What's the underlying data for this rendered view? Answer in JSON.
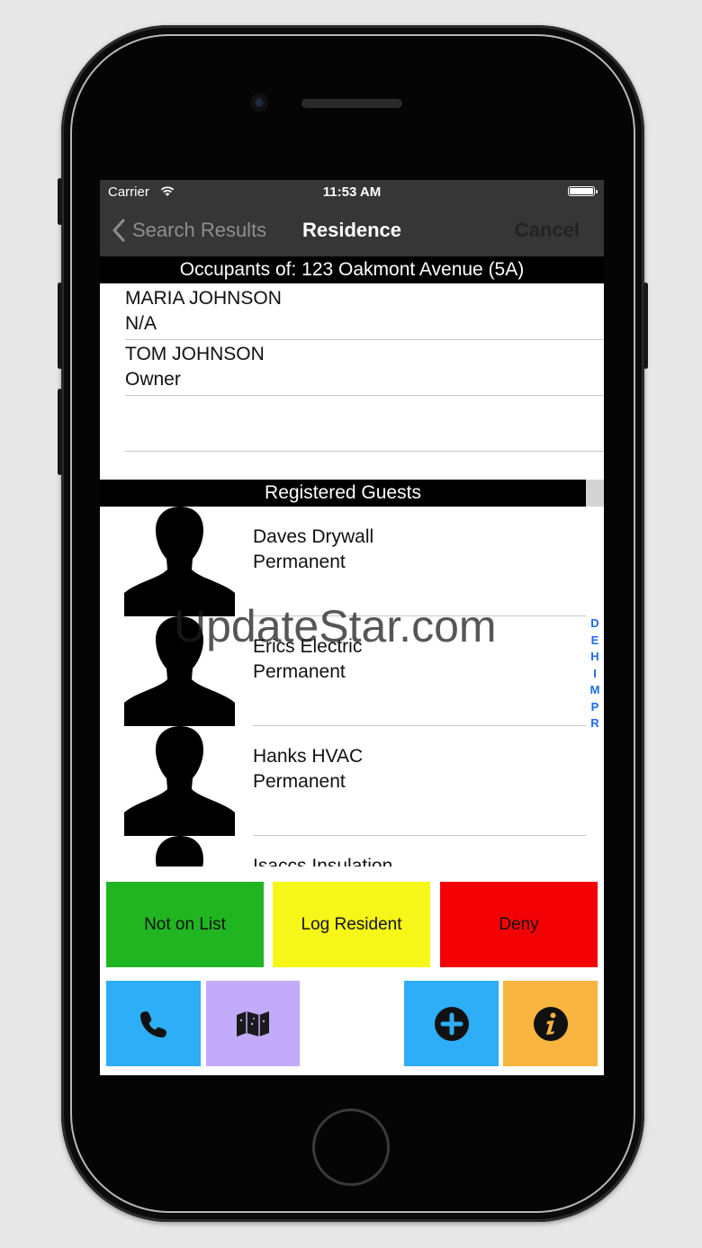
{
  "status_bar": {
    "carrier": "Carrier",
    "time": "11:53 AM"
  },
  "nav": {
    "back_label": "Search Results",
    "title": "Residence",
    "cancel_label": "Cancel"
  },
  "occupants": {
    "header": "Occupants of: 123 Oakmont Avenue (5A)",
    "rows": [
      {
        "name": "MARIA JOHNSON",
        "role": "N/A"
      },
      {
        "name": "TOM JOHNSON",
        "role": "Owner"
      }
    ]
  },
  "guests": {
    "header": "Registered Guests",
    "rows": [
      {
        "name": "Daves Drywall",
        "type": "Permanent"
      },
      {
        "name": "Erics Electric",
        "type": "Permanent"
      },
      {
        "name": "Hanks HVAC",
        "type": "Permanent"
      },
      {
        "name": "Isaccs Insulation",
        "type": ""
      }
    ],
    "index_letters": [
      "D",
      "E",
      "H",
      "I",
      "M",
      "P",
      "R"
    ]
  },
  "watermark": "UpdateStar.com",
  "actions": {
    "not_on_list": {
      "label": "Not on List",
      "color": "#22b522"
    },
    "log_resident": {
      "label": "Log Resident",
      "color": "#f6f619"
    },
    "deny": {
      "label": "Deny",
      "color": "#f40105"
    },
    "call": {
      "icon": "phone-icon",
      "color": "#2eaef7"
    },
    "map": {
      "icon": "map-icon",
      "color": "#c2abfb"
    },
    "add": {
      "icon": "plus-circle-icon",
      "color": "#2eaef7"
    },
    "info": {
      "icon": "info-icon",
      "color": "#f9b53f"
    }
  }
}
